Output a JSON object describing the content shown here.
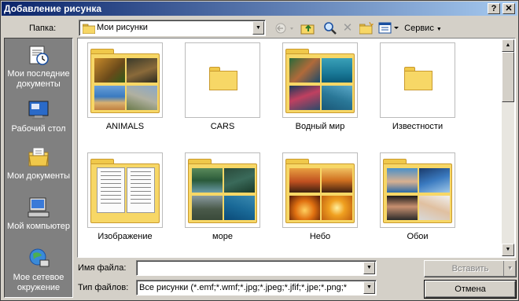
{
  "window": {
    "title": "Добавление рисунка",
    "help_button": "?",
    "close_button": "✕"
  },
  "lookin": {
    "label": "Папка:",
    "value": "Мои рисунки"
  },
  "toolbar": {
    "service_label": "Сервис"
  },
  "places": [
    {
      "label": "Мои последние документы",
      "icon": "recent-documents-icon"
    },
    {
      "label": "Рабочий стол",
      "icon": "desktop-icon"
    },
    {
      "label": "Мои документы",
      "icon": "my-documents-icon"
    },
    {
      "label": "Мой компьютер",
      "icon": "my-computer-icon"
    },
    {
      "label": "Мое сетевое окружение",
      "icon": "network-places-icon"
    }
  ],
  "items": [
    {
      "name": "ANIMALS",
      "kind": "photos"
    },
    {
      "name": "CARS",
      "kind": "empty"
    },
    {
      "name": "Водный мир",
      "kind": "photos"
    },
    {
      "name": "Известности",
      "kind": "empty"
    },
    {
      "name": "Изображение",
      "kind": "documents"
    },
    {
      "name": "море",
      "kind": "photos"
    },
    {
      "name": "Небо",
      "kind": "photos"
    },
    {
      "name": "Обои",
      "kind": "photos"
    }
  ],
  "filename": {
    "label": "Имя файла:",
    "value": ""
  },
  "filetype": {
    "label": "Тип файлов:",
    "value": "Все рисунки (*.emf;*.wmf;*.jpg;*.jpeg;*.jfif;*.jpe;*.png;*"
  },
  "buttons": {
    "insert": "Вставить",
    "cancel": "Отмена"
  },
  "colors": {
    "title_bar": "#0a246a",
    "folder": "#f7d766",
    "places_panel": "#808080"
  }
}
